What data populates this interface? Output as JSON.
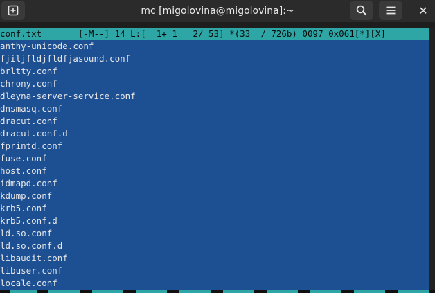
{
  "window": {
    "title": "mc [migolovina@migolovina]:~",
    "close_glyph": "✕",
    "icons": [
      "new-tab-icon",
      "search-icon",
      "hamburger-menu-icon",
      "close-icon"
    ]
  },
  "editor": {
    "status_line": "conf.txt       [-M--] 14 L:[  1+ 1   2/ 53] *(33  / 726b) 0097 0x061[*][X]",
    "lines": [
      "anthy-unicode.conf",
      "fjiljfldjfldfjasound.conf",
      "brltty.conf",
      "chrony.conf",
      "dleyna-server-service.conf",
      "dnsmasq.conf",
      "dracut.conf",
      "dracut.conf.d",
      "fprintd.conf",
      "fuse.conf",
      "host.conf",
      "idmapd.conf",
      "kdump.conf",
      "krb5.conf",
      "krb5.conf.d",
      "ld.so.conf",
      "ld.so.conf.d",
      "libaudit.conf",
      "libuser.conf",
      "locale.conf"
    ]
  },
  "colors": {
    "panel_bg": "#1d4f93",
    "status_bg": "#2ea6a6",
    "titlebar_bg": "#2b2b2b"
  }
}
